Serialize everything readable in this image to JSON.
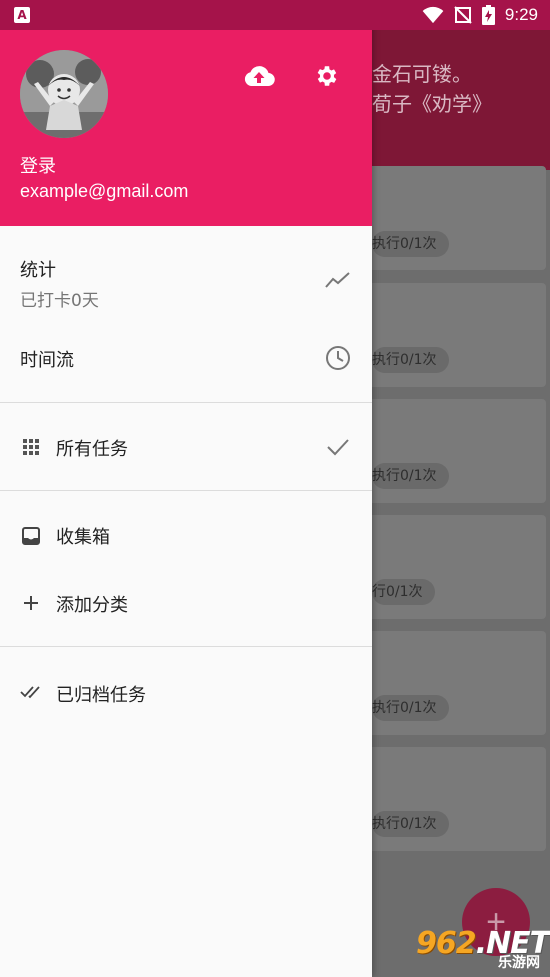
{
  "status_bar": {
    "app_icon": "A",
    "time": "9:29",
    "icons": [
      "wifi-icon",
      "no-notification-icon",
      "battery-charging-icon"
    ]
  },
  "background": {
    "quote_line1": "金石可镂。",
    "quote_line2": "荀子《劝学》",
    "cards": [
      {
        "chip": "执行0/1次"
      },
      {
        "chip": "执行0/1次"
      },
      {
        "chip": "执行0/1次"
      },
      {
        "chip": "行0/1次"
      },
      {
        "chip": "执行0/1次"
      },
      {
        "chip": "执行0/1次"
      }
    ],
    "fab_symbol": "+"
  },
  "watermark": {
    "brand_a": "962",
    "brand_b": ".NET",
    "sub": "乐游网"
  },
  "drawer": {
    "header_color": "#ea1e63",
    "login_label": "登录",
    "email": "example@gmail.com",
    "upload_icon": "cloud-upload-icon",
    "settings_icon": "gear-icon",
    "items": [
      {
        "label": "统计",
        "sublabel": "已打卡0天",
        "icon": "trending-icon"
      },
      {
        "label": "时间流",
        "icon": "clock-icon"
      },
      {
        "label": "所有任务",
        "icon": "grid-icon",
        "right_icon": "check-icon"
      },
      {
        "label": "收集箱",
        "icon": "inbox-icon"
      },
      {
        "label": "添加分类",
        "icon": "plus-icon"
      },
      {
        "label": "已归档任务",
        "icon": "double-check-icon"
      }
    ]
  }
}
